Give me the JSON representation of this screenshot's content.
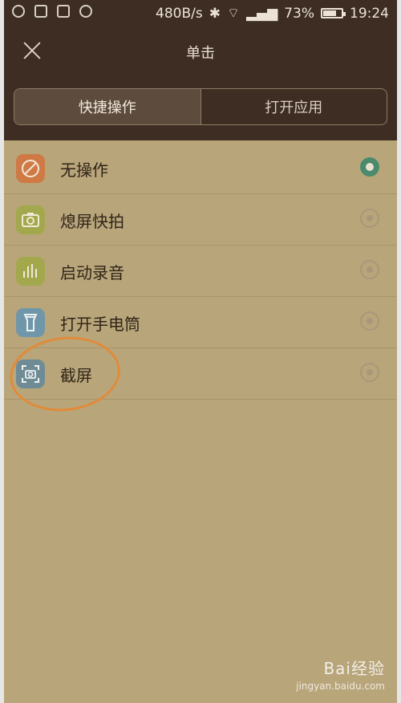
{
  "status": {
    "speed": "480B/s",
    "battery": "73%",
    "time": "19:24",
    "battery_level": 0.73
  },
  "header": {
    "title": "单击"
  },
  "tabs": [
    {
      "label": "快捷操作",
      "active": true
    },
    {
      "label": "打开应用",
      "active": false
    }
  ],
  "options": [
    {
      "label": "无操作",
      "icon": "no-action-icon",
      "color": "#cf7a44",
      "selected": true
    },
    {
      "label": "熄屏快拍",
      "icon": "camera-icon",
      "color": "#a3a84c",
      "selected": false
    },
    {
      "label": "启动录音",
      "icon": "audio-bars-icon",
      "color": "#a3a84c",
      "selected": false
    },
    {
      "label": "打开手电筒",
      "icon": "flashlight-icon",
      "color": "#6f96a9",
      "selected": false
    },
    {
      "label": "截屏",
      "icon": "screenshot-icon",
      "color": "#6f8c96",
      "selected": false
    }
  ],
  "watermark": {
    "logo": "Bai",
    "logo_suffix": "经验",
    "url": "jingyan.baidu.com"
  }
}
